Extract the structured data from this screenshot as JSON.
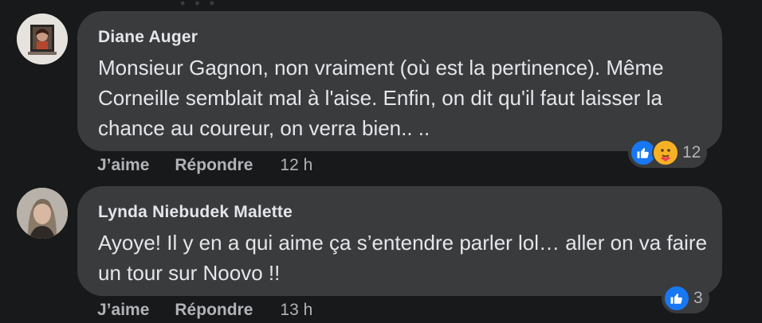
{
  "comments": [
    {
      "author": "Diane Auger",
      "text": "Monsieur Gagnon, non vraiment (où est la pertinence). Même Corneille semblait mal à l'aise. Enfin, on dit qu'il faut laisser la chance au coureur, on verra bien.. ..",
      "like_label": "J’aime",
      "reply_label": "Répondre",
      "time": "12 h",
      "reaction_count": "12",
      "reaction_icons": [
        "like-icon",
        "care-icon"
      ]
    },
    {
      "author": "Lynda Niebudek Malette",
      "text": "Ayoye! Il y en a qui aime ça s’entendre parler lol… aller on va faire un tour sur Noovo !!",
      "like_label": "J’aime",
      "reply_label": "Répondre",
      "time": "13 h",
      "reaction_count": "3",
      "reaction_icons": [
        "like-icon"
      ]
    }
  ],
  "colors": {
    "background": "#18191a",
    "bubble": "#3a3b3c",
    "primary_text": "#e4e6eb",
    "secondary_text": "#b0b3b8",
    "like_blue": "#1877f2",
    "care_yellow": "#f7b125"
  }
}
